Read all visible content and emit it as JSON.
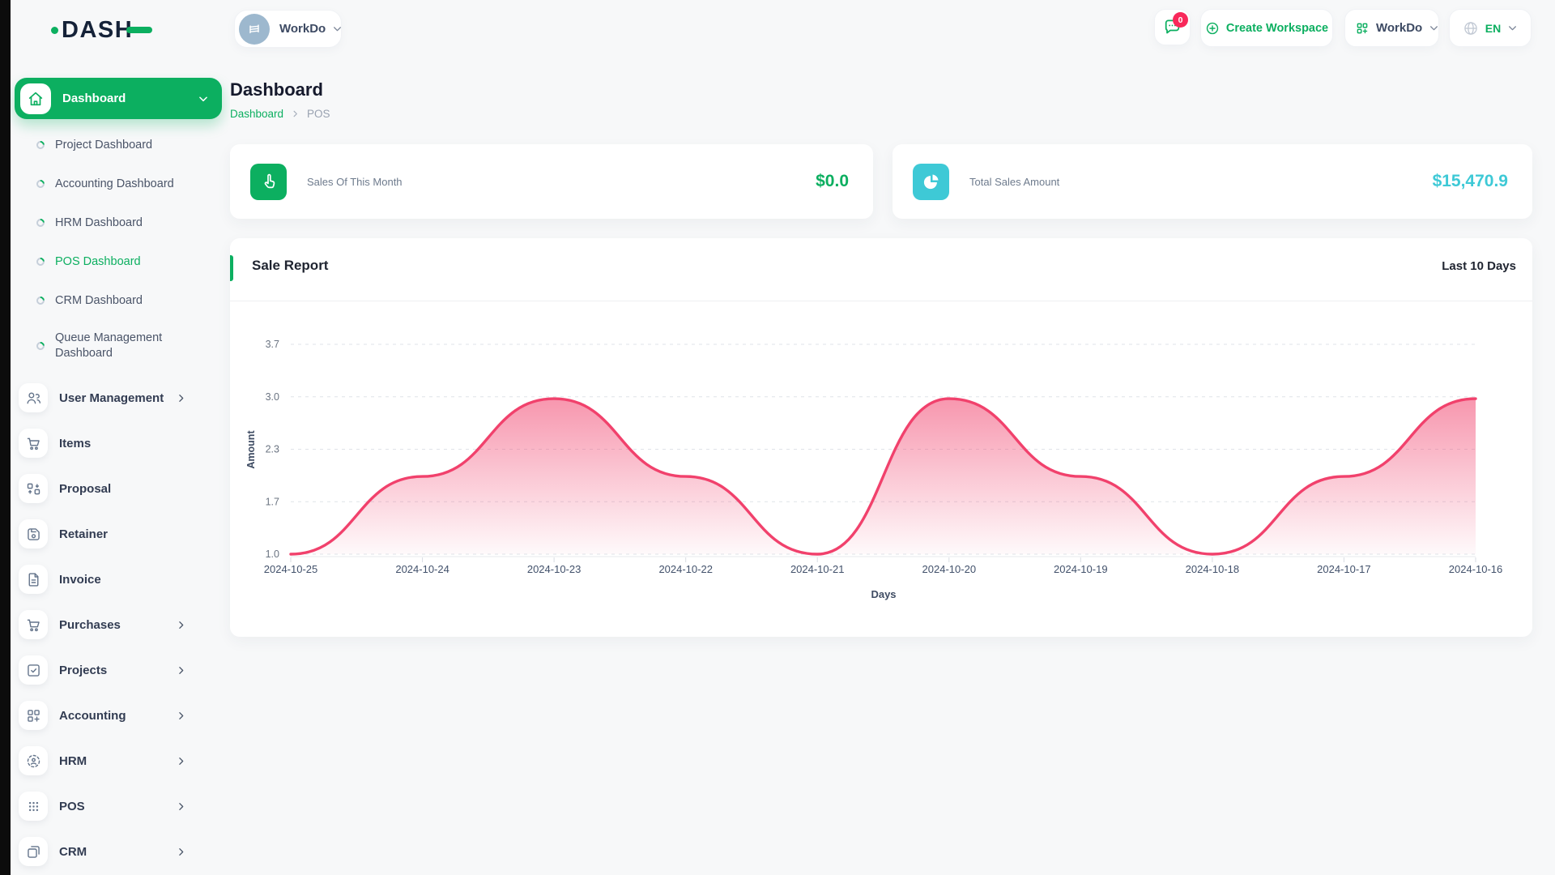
{
  "header": {
    "logo_text": "DASH",
    "workspace_switcher": {
      "label": "WorkDo",
      "icon": "building-avatar-icon"
    },
    "notification": {
      "badge": "0",
      "icon": "chat-bubble-icon"
    },
    "create_workspace": {
      "label": "Create Workspace",
      "icon": "plus-circle-icon"
    },
    "workspace_menu": {
      "label": "WorkDo",
      "icon": "grid-plus-icon"
    },
    "language": {
      "label": "EN",
      "icon": "globe-icon"
    }
  },
  "sidebar": {
    "dashboard": {
      "label": "Dashboard",
      "icon": "home-icon",
      "sub_items": [
        "Project Dashboard",
        "Accounting Dashboard",
        "HRM Dashboard",
        "POS Dashboard",
        "CRM Dashboard",
        "Queue Management Dashboard"
      ],
      "active_sub_item": "POS Dashboard"
    },
    "menu": [
      {
        "label": "User Management",
        "icon": "users-icon",
        "chevron": true
      },
      {
        "label": "Items",
        "icon": "cart-icon",
        "chevron": false
      },
      {
        "label": "Proposal",
        "icon": "workflow-icon",
        "chevron": false
      },
      {
        "label": "Retainer",
        "icon": "floppy-icon",
        "chevron": false
      },
      {
        "label": "Invoice",
        "icon": "document-icon",
        "chevron": false
      },
      {
        "label": "Purchases",
        "icon": "cart-icon",
        "chevron": true
      },
      {
        "label": "Projects",
        "icon": "check-square-icon",
        "chevron": true
      },
      {
        "label": "Accounting",
        "icon": "grid-plus-icon",
        "chevron": true
      },
      {
        "label": "HRM",
        "icon": "person-circle-icon",
        "chevron": true
      },
      {
        "label": "POS",
        "icon": "dots-grid-icon",
        "chevron": true
      },
      {
        "label": "CRM",
        "icon": "overlap-squares-icon",
        "chevron": true
      }
    ]
  },
  "page": {
    "title": "Dashboard",
    "breadcrumb": {
      "home": "Dashboard",
      "current": "POS"
    }
  },
  "stats": [
    {
      "label": "Sales Of This Month",
      "value": "$0.0",
      "icon": "hand-tap-icon",
      "color": "#0caf60"
    },
    {
      "label": "Total Sales Amount",
      "value": "$15,470.9",
      "icon": "pie-chart-icon",
      "color": "#3ec9d6"
    }
  ],
  "chart_card": {
    "title": "Sale Report",
    "range_label": "Last 10 Days"
  },
  "chart_data": {
    "type": "area",
    "title": "Sale Report",
    "x": [
      "2024-10-25",
      "2024-10-24",
      "2024-10-23",
      "2024-10-22",
      "2024-10-21",
      "2024-10-20",
      "2024-10-19",
      "2024-10-18",
      "2024-10-17",
      "2024-10-16"
    ],
    "series": [
      {
        "name": "Amount",
        "values": [
          1,
          2,
          3,
          2,
          1,
          3,
          2,
          1,
          2,
          3
        ]
      }
    ],
    "xlabel": "Days",
    "ylabel": "Amount",
    "ylim": [
      1.0,
      3.7
    ],
    "ytick_labels": [
      "1.0",
      "1.7",
      "2.3",
      "3.0",
      "3.7"
    ],
    "grid": "dashed-horizontal",
    "curve": "smooth",
    "line_color": "#f1416c",
    "fill_color": "#f1416c",
    "legend": "none"
  },
  "colors": {
    "primary": "#0caf60",
    "info": "#3ec9d6",
    "danger": "#f1416c",
    "badge": "#f8285a"
  }
}
